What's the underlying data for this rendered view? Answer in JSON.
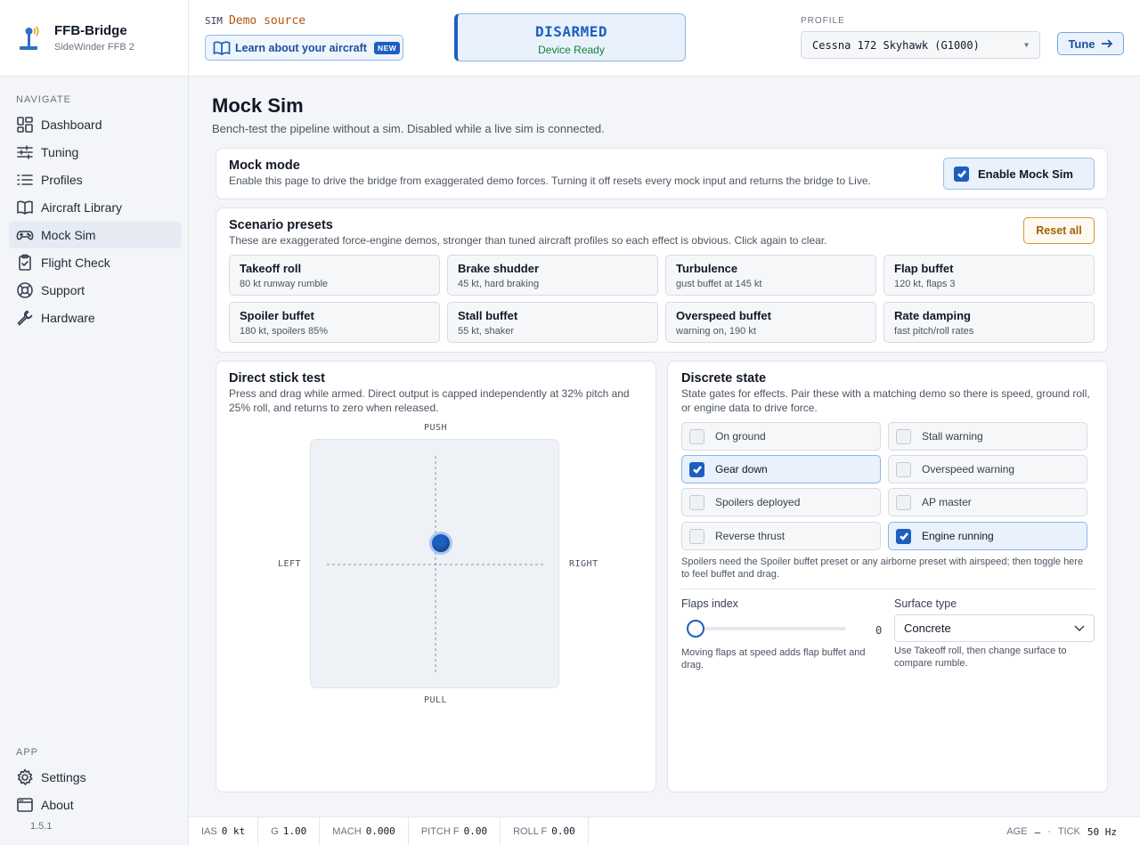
{
  "app": {
    "name": "FFB-Bridge",
    "device": "SideWinder FFB 2",
    "version": "1.5.1"
  },
  "nav": {
    "heading": "NAVIGATE",
    "items": [
      {
        "label": "Dashboard"
      },
      {
        "label": "Tuning"
      },
      {
        "label": "Profiles"
      },
      {
        "label": "Aircraft Library"
      },
      {
        "label": "Mock Sim"
      },
      {
        "label": "Flight Check"
      },
      {
        "label": "Support"
      },
      {
        "label": "Hardware"
      }
    ],
    "active": "Mock Sim",
    "app_heading": "APP",
    "app_items": [
      {
        "label": "Settings"
      },
      {
        "label": "About"
      }
    ]
  },
  "header": {
    "sim_label": "SIM",
    "sim_source": "Demo source",
    "learn_label": "Learn about your aircraft",
    "new_badge": "NEW",
    "status_title": "DISARMED",
    "status_sub": "Device Ready",
    "profile_label": "PROFILE",
    "profile_value": "Cessna 172 Skyhawk (G1000)",
    "tune_label": "Tune"
  },
  "page": {
    "title": "Mock Sim",
    "description": "Bench-test the pipeline without a sim. Disabled while a live sim is connected."
  },
  "mock_mode": {
    "title": "Mock mode",
    "description": "Enable this page to drive the bridge from exaggerated demo forces. Turning it off resets every mock input and returns the bridge to Live.",
    "toggle_label": "Enable Mock Sim",
    "enabled": true
  },
  "presets": {
    "title": "Scenario presets",
    "description": "These are exaggerated force-engine demos, stronger than tuned aircraft profiles so each effect is obvious. Click again to clear.",
    "reset_label": "Reset all",
    "items": [
      {
        "name": "Takeoff roll",
        "desc": "80 kt runway rumble"
      },
      {
        "name": "Brake shudder",
        "desc": "45 kt, hard braking"
      },
      {
        "name": "Turbulence",
        "desc": "gust buffet at 145 kt"
      },
      {
        "name": "Flap buffet",
        "desc": "120 kt, flaps 3"
      },
      {
        "name": "Spoiler buffet",
        "desc": "180 kt, spoilers 85%"
      },
      {
        "name": "Stall buffet",
        "desc": "55 kt, shaker"
      },
      {
        "name": "Overspeed buffet",
        "desc": "warning on, 190 kt"
      },
      {
        "name": "Rate damping",
        "desc": "fast pitch/roll rates"
      }
    ]
  },
  "stick": {
    "title": "Direct stick test",
    "description": "Press and drag while armed. Direct output is capped independently at 32% pitch and 25% roll, and returns to zero when released.",
    "push": "PUSH",
    "pull": "PULL",
    "left": "LEFT",
    "right": "RIGHT",
    "pitch_fraction": 0.2,
    "roll_fraction": 0.05
  },
  "discrete": {
    "title": "Discrete state",
    "description": "State gates for effects. Pair these with a matching demo so there is speed, ground roll, or engine data to drive force.",
    "items": [
      {
        "label": "On ground",
        "checked": false
      },
      {
        "label": "Stall warning",
        "checked": false
      },
      {
        "label": "Gear down",
        "checked": true
      },
      {
        "label": "Overspeed warning",
        "checked": false
      },
      {
        "label": "Spoilers deployed",
        "checked": false
      },
      {
        "label": "AP master",
        "checked": false
      },
      {
        "label": "Reverse thrust",
        "checked": false
      },
      {
        "label": "Engine running",
        "checked": true
      }
    ],
    "note": "Spoilers need the Spoiler buffet preset or any airborne preset with airspeed; then toggle here to feel buffet and drag.",
    "flaps_label": "Flaps index",
    "flaps_value": "0",
    "flaps_note": "Moving flaps at speed adds flap buffet and drag.",
    "surface_label": "Surface type",
    "surface_value": "Concrete",
    "surface_note": "Use Takeoff roll, then change surface to compare rumble."
  },
  "status_bar": {
    "cells": [
      {
        "label": "IAS",
        "value": "0 kt"
      },
      {
        "label": "G",
        "value": "1.00"
      },
      {
        "label": "MACH",
        "value": "0.000"
      },
      {
        "label": "PITCH F",
        "value": "0.00"
      },
      {
        "label": "ROLL F",
        "value": "0.00"
      }
    ],
    "age_label": "AGE",
    "age_value": "—",
    "separator": "·",
    "tick_label": "TICK",
    "tick_value": "50 Hz"
  },
  "colors": {
    "accent": "#1d5fbf",
    "warning": "#b45309",
    "ok": "#15803d"
  }
}
